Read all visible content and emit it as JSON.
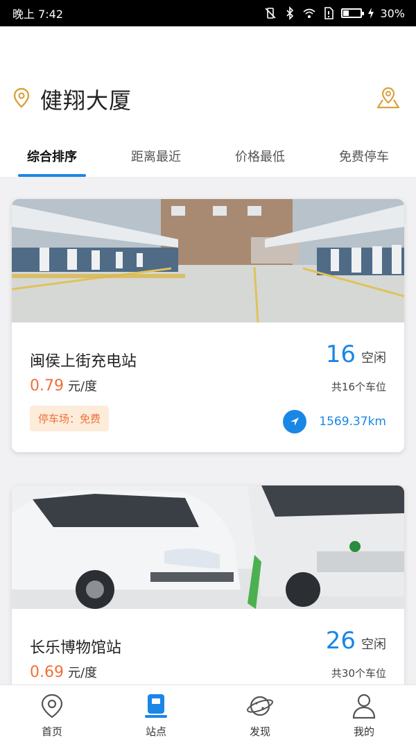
{
  "status_bar": {
    "time": "晚上 7:42",
    "battery_percent": "30%",
    "battery_level": 0.3,
    "icons": [
      "vibrate-off-icon",
      "bluetooth-icon",
      "wifi-icon",
      "sim-alert-icon",
      "battery-icon",
      "charging-icon"
    ]
  },
  "header": {
    "location_name": "健翔大厦",
    "location_icon": "location-pin-icon",
    "map_icon": "map-location-icon"
  },
  "tabs": [
    {
      "label": "综合排序",
      "active": true
    },
    {
      "label": "距离最近",
      "active": false
    },
    {
      "label": "价格最低",
      "active": false
    },
    {
      "label": "免费停车",
      "active": false
    }
  ],
  "stations": [
    {
      "name": "闽侯上街充电站",
      "price": "0.79",
      "unit": "元/度",
      "free_count": "16",
      "free_label": "空闲",
      "total_label": "共16个车位",
      "parking_label": "停车场：免费",
      "distance": "1569.37km"
    },
    {
      "name": "长乐博物馆站",
      "price": "0.69",
      "unit": "元/度",
      "free_count": "26",
      "free_label": "空闲",
      "total_label": "共30个车位"
    }
  ],
  "bottom_nav": [
    {
      "label": "首页",
      "icon": "home-pin-icon",
      "active": false
    },
    {
      "label": "站点",
      "icon": "charging-station-icon",
      "active": true
    },
    {
      "label": "发现",
      "icon": "planet-icon",
      "active": false
    },
    {
      "label": "我的",
      "icon": "user-icon",
      "active": false
    }
  ],
  "colors": {
    "accent": "#1a86e6",
    "price": "#f0703a",
    "pin": "#d9a23b",
    "park_bg": "#fdecd9"
  }
}
